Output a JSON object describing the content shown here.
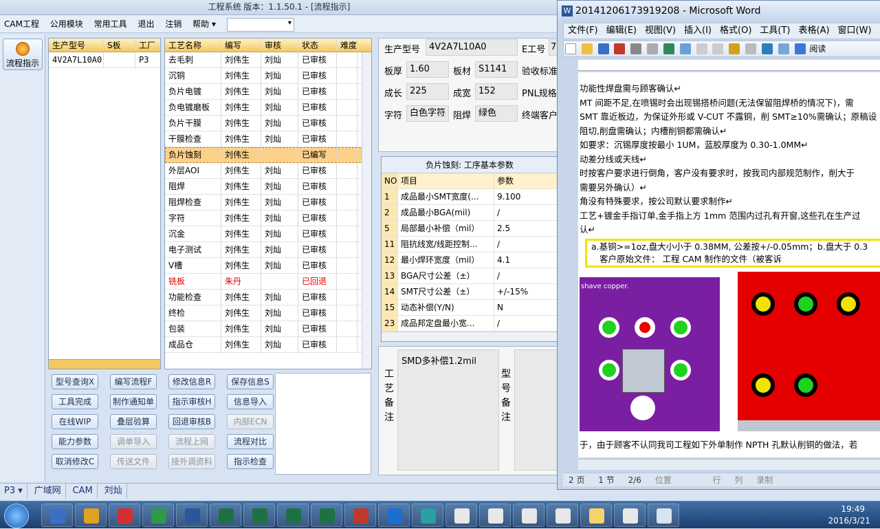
{
  "app": {
    "title": "工程系统  版本：1.1.50.1 - [流程指示]"
  },
  "menu": {
    "items": [
      "CAM工程",
      "公用模块",
      "常用工具",
      "退出",
      "注销",
      "帮助"
    ]
  },
  "left": {
    "flow_button": "流程指示"
  },
  "product_grid": {
    "headers": [
      "生产型号",
      "S板",
      "工厂"
    ],
    "rows": [
      {
        "model": "4V2A7L10A0",
        "s": "",
        "factory": "P3"
      }
    ]
  },
  "process_grid": {
    "headers": [
      "工艺名称",
      "编写",
      "审核",
      "状态",
      "难度"
    ],
    "rows": [
      {
        "name": "去毛刺",
        "writer": "刘伟生",
        "reviewer": "刘灿",
        "status": "已审核"
      },
      {
        "name": "沉铜",
        "writer": "刘伟生",
        "reviewer": "刘灿",
        "status": "已审核"
      },
      {
        "name": "负片电镀",
        "writer": "刘伟生",
        "reviewer": "刘灿",
        "status": "已审核"
      },
      {
        "name": "负电镀磨板",
        "writer": "刘伟生",
        "reviewer": "刘灿",
        "status": "已审核"
      },
      {
        "name": "负片干膜",
        "writer": "刘伟生",
        "reviewer": "刘灿",
        "status": "已审核"
      },
      {
        "name": "干膜检查",
        "writer": "刘伟生",
        "reviewer": "刘灿",
        "status": "已审核"
      },
      {
        "name": "负片蚀刻",
        "writer": "刘伟生",
        "reviewer": "",
        "status": "已编写"
      },
      {
        "name": "外层AOI",
        "writer": "刘伟生",
        "reviewer": "刘灿",
        "status": "已审核"
      },
      {
        "name": "阻焊",
        "writer": "刘伟生",
        "reviewer": "刘灿",
        "status": "已审核"
      },
      {
        "name": "阻焊检查",
        "writer": "刘伟生",
        "reviewer": "刘灿",
        "status": "已审核"
      },
      {
        "name": "字符",
        "writer": "刘伟生",
        "reviewer": "刘灿",
        "status": "已审核"
      },
      {
        "name": "沉金",
        "writer": "刘伟生",
        "reviewer": "刘灿",
        "status": "已审核"
      },
      {
        "name": "电子测试",
        "writer": "刘伟生",
        "reviewer": "刘灿",
        "status": "已审核"
      },
      {
        "name": "V槽",
        "writer": "刘伟生",
        "reviewer": "刘灿",
        "status": "已审核"
      },
      {
        "name": "铣板",
        "writer": "朱丹",
        "reviewer": "",
        "status": "已回退"
      },
      {
        "name": "功能检查",
        "writer": "刘伟生",
        "reviewer": "刘灿",
        "status": "已审核"
      },
      {
        "name": "终检",
        "writer": "刘伟生",
        "reviewer": "刘灿",
        "status": "已审核"
      },
      {
        "name": "包装",
        "writer": "刘伟生",
        "reviewer": "刘灿",
        "status": "已审核"
      },
      {
        "name": "成品仓",
        "writer": "刘伟生",
        "reviewer": "刘灿",
        "status": "已审核"
      }
    ]
  },
  "buttons": [
    {
      "label": "型号查询X",
      "disabled": false
    },
    {
      "label": "编写流程F",
      "disabled": false
    },
    {
      "label": "修改信息R",
      "disabled": false
    },
    {
      "label": "保存信息S",
      "disabled": false
    },
    {
      "label": "工具完成",
      "disabled": false
    },
    {
      "label": "制作通知单",
      "disabled": false
    },
    {
      "label": "指示审核H",
      "disabled": false
    },
    {
      "label": "信息导入",
      "disabled": false
    },
    {
      "label": "在线WIP",
      "disabled": false
    },
    {
      "label": "叠层验算",
      "disabled": false
    },
    {
      "label": "回退审核B",
      "disabled": false
    },
    {
      "label": "内部ECN",
      "disabled": true
    },
    {
      "label": "能力参数",
      "disabled": false
    },
    {
      "label": "调单导入",
      "disabled": true
    },
    {
      "label": "流程上网",
      "disabled": true
    },
    {
      "label": "流程对比",
      "disabled": false
    },
    {
      "label": "取消修改C",
      "disabled": false
    },
    {
      "label": "传送文件",
      "disabled": true
    },
    {
      "label": "接外调资料",
      "disabled": true
    },
    {
      "label": "指示检查",
      "disabled": false
    }
  ],
  "info": {
    "model_label": "生产型号",
    "model_value": "4V2A7L10A0",
    "eng_label": "E工号",
    "eng_value": "7",
    "thick_label": "板厚",
    "thick_value": "1.60",
    "material_label": "板材",
    "material_value": "S1141",
    "verify_label": "验收标准",
    "len_label": "成长",
    "len_value": "225",
    "width_label": "成宽",
    "width_value": "152",
    "pnl_label": "PNL规格",
    "char_label": "字符",
    "char_value": "白色字符",
    "mask_label": "阻焊",
    "mask_value": "绿色",
    "cust_label": "终端客户"
  },
  "param_table": {
    "title": "负片蚀刻: 工序基本参数",
    "headers": [
      "NO",
      "项目",
      "参数"
    ],
    "rows": [
      {
        "no": "1",
        "item": "成品最小SMT宽度(...",
        "val": "9.100"
      },
      {
        "no": "2",
        "item": "成品最小BGA(mil)",
        "val": "/"
      },
      {
        "no": "5",
        "item": "局部最小补偿（mil）",
        "val": "2.5"
      },
      {
        "no": "11",
        "item": "阻抗线宽/线距控制...",
        "val": "/"
      },
      {
        "no": "12",
        "item": "最小焊环宽度（mil）",
        "val": "4.1"
      },
      {
        "no": "13",
        "item": "BGA尺寸公差（±）",
        "val": "/"
      },
      {
        "no": "14",
        "item": "SMT尺寸公差（±）",
        "val": "+/-15%"
      },
      {
        "no": "15",
        "item": "动态补偿(Y/N)",
        "val": "N"
      },
      {
        "no": "23",
        "item": "成品邦定盘最小宽...",
        "val": "/"
      }
    ]
  },
  "notes": {
    "process_label": "工艺备注",
    "process_text": "SMD多补偿1.2mil",
    "model_label": "型号备注"
  },
  "status": {
    "items": [
      "P3",
      "广域网",
      "CAM",
      "刘灿"
    ]
  },
  "word": {
    "title": "20141206173919208 - Microsoft Word",
    "menu": [
      "文件(F)",
      "编辑(E)",
      "视图(V)",
      "插入(I)",
      "格式(O)",
      "工具(T)",
      "表格(A)",
      "窗口(W)"
    ],
    "reading": "阅读",
    "lines": [
      "功能性焊盘需与顾客确认↵",
      "MT 间距不足,在喷锡时会出现锡搭桥问题(无法保留阻焊桥的情况下)，需",
      "SMT 靠近板边，为保证外形或 V-CUT 不露铜，削 SMT≥10%需确认；原稿设",
      "阻切,削盘需确认；内槽削铜都需确认↵",
      "如要求：沉锡厚度按最小 1UM，蓝胶厚度为 0.30-1.0MM↵",
      "动差分线或天线↵",
      "时按客户要求进行倒角，客户没有要求时，按我司内部规范制作，削大于",
      "需要另外确认）↵",
      "角没有特殊要求，按公司默认要求制作↵",
      "工艺+镀金手指订单,金手指上方 1mm 范围内过孔有开窗,这些孔在生产过",
      "认↵"
    ],
    "hl1": "a.基铜>=1oz,盘大小小于 0.38MM, 公差按+/-0.05mm；b.盘大于 0.3",
    "hl2": "客户原始文件：              工程 CAM 制作的文件（被客诉",
    "img_caption": "shave copper.",
    "bottom_line": "于，由于顾客不认同我司工程如下外单制作 NPTH 孔默认削铜的做法，若",
    "status": [
      "2 页",
      "1 节",
      "2/6",
      "位置",
      "行",
      "列",
      "录制"
    ]
  },
  "taskbar": {
    "time": "19:49",
    "date": "2016/3/21"
  }
}
